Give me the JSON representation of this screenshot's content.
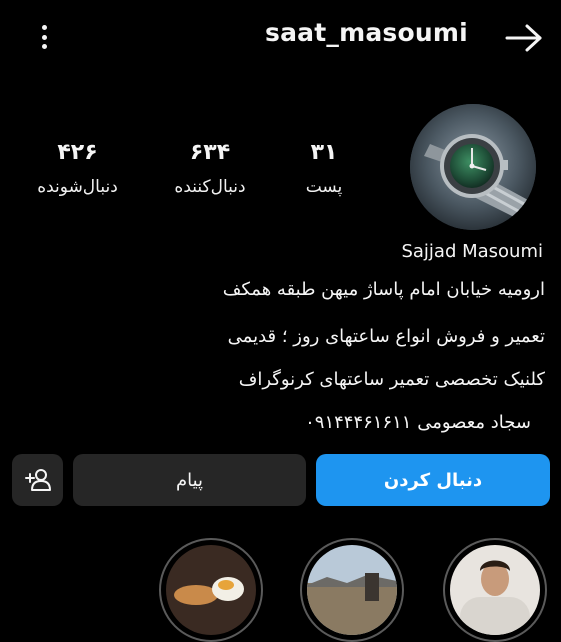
{
  "header": {
    "username": "saat_masoumi"
  },
  "stats": {
    "posts": {
      "value": "۳۱",
      "label": "پست"
    },
    "followers": {
      "value": "۶۳۴",
      "label": "دنبال‌کننده"
    },
    "following": {
      "value": "۴۲۶",
      "label": "دنبال‌شونده"
    }
  },
  "bio": {
    "name": "Sajjad Masoumi",
    "lines": [
      "ارومیه خیابان امام پاساژ میهن طبقه همکف",
      "تعمیر و فروش انواع ساعتهای روز ؛ قدیمی",
      "کلنیک تخصصی تعمیر ساعتهای کرنوگراف",
      "سجاد معصومی ۰۹۱۴۴۴۶۱۶۱۱"
    ]
  },
  "actions": {
    "follow_label": "دنبال کردن",
    "message_label": "پیام"
  },
  "colors": {
    "background": "#000000",
    "follow_button": "#1e95f0",
    "secondary_button": "#262626",
    "text": "#f5f5f5"
  },
  "icons": {
    "menu": "more-vertical-icon",
    "back": "arrow-right-icon",
    "add_user": "add-person-icon"
  },
  "highlights": [
    {
      "name": "highlight-person"
    },
    {
      "name": "highlight-landscape"
    },
    {
      "name": "highlight-food"
    }
  ]
}
